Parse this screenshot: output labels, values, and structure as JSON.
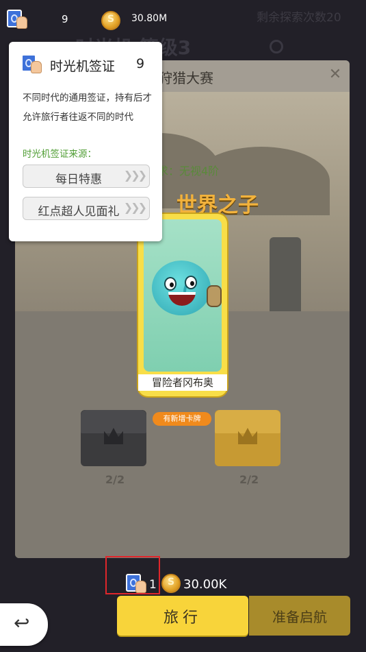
{
  "header": {
    "visa_count": "9",
    "coins": "30.80M",
    "explore_remaining": "剩余探索次数20",
    "bg_title": "时光机 等级3"
  },
  "panel": {
    "heading": "狩猎大赛",
    "requirement": "求：无视4阶",
    "stage_title": "世界之子"
  },
  "card": {
    "name": "冒险者冈布奥",
    "new_badge": "有新增卡牌"
  },
  "chests": [
    {
      "count": "2/2",
      "color": "#3b3b3d"
    },
    {
      "count": "2/2",
      "color": "#c79a33"
    }
  ],
  "tooltip": {
    "title": "时光机签证",
    "count": "9",
    "desc": "不同时代的通用签证，持有后才允许旅行者往返不同的时代",
    "source_label": "时光机签证来源：",
    "sources": [
      "每日特惠",
      "红点超人见面礼"
    ]
  },
  "cost": {
    "visa": "1",
    "coins": "30.00K"
  },
  "buttons": {
    "travel": "旅行",
    "depart": "准备启航"
  },
  "colors": {
    "accent_yellow": "#f8d43a",
    "badge_orange": "#f08a1c",
    "highlight_red": "#e0262b",
    "source_green": "#4f9d33"
  },
  "icons": [
    "visa-icon",
    "coin-icon",
    "search-icon",
    "close-icon",
    "back-arrow-icon",
    "chevron-arrows-icon"
  ]
}
